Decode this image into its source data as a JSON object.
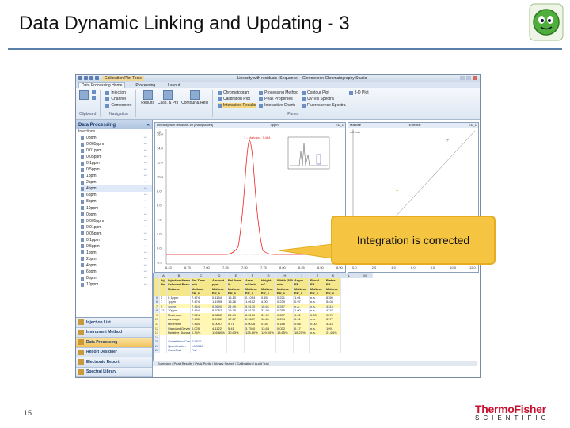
{
  "slide": {
    "title": "Data Dynamic Linking and Updating - 3",
    "page_number": "15",
    "company_word": "ThermoFisher",
    "company_sub": "SCIENTIFIC",
    "callout": "Integration is corrected"
  },
  "app": {
    "context_tab": "Calibration Plot Tools",
    "window_title": "Linearity with residuals (Sequence) - Chromeleon Chromatography Studio",
    "tabs": [
      "Data Processing Home",
      "Processing",
      "Layout"
    ],
    "ribbon": {
      "clipboard": "Clipboard",
      "navigation": "Navigation",
      "nav_items": [
        "Injection",
        "Channel",
        "Component"
      ],
      "results": [
        "Results",
        "Calib. & Ptfl",
        "Contour & Resi"
      ],
      "panes_label": "Panes",
      "panes_col1": [
        "Chromatogram",
        "Calibration Plot",
        "Interactive Results"
      ],
      "panes_col2": [
        "Processing Method",
        "Peak Properties",
        "Interactive Charts"
      ],
      "panes_col3": [
        "Contour Plot",
        "UV-Vis Spectra",
        "Fluorescence Spectra"
      ],
      "panes_col4": [
        "3-D Plot"
      ]
    },
    "nav": {
      "title": "Data Processing",
      "section": "Injections",
      "items": [
        "0ppm",
        "0.005ppm",
        "0.01ppm",
        "0.05ppm",
        "0.1ppm",
        "0.5ppm",
        "1ppm",
        "2ppm",
        "4ppm",
        "6ppm",
        "8ppm",
        "10ppm",
        "0ppm",
        "0.005ppm",
        "0.01ppm",
        "0.05ppm",
        "0.1ppm",
        "0.5ppm",
        "1ppm",
        "2ppm",
        "4ppm",
        "6ppm",
        "8ppm",
        "10ppm"
      ],
      "selected_index": 8,
      "buttons": [
        "Injection List",
        "Instrument Method",
        "Data Processing",
        "Report Designer",
        "Electronic Report",
        "Spectral Library"
      ]
    },
    "chromatogram": {
      "header": "Linearity with residuals #9 [manipulated]",
      "header_mid": "4ppm",
      "header_right": "ED_1",
      "unit": "nC",
      "peak_label": "1 - Maltose - 7.464",
      "y_ticks": [
        "16.0",
        "14.0",
        "12.0",
        "10.0",
        "8.0",
        "6.0",
        "4.0",
        "2.0",
        "0.0",
        "-2.0"
      ],
      "x_ticks": [
        "6.43",
        "6.75",
        "7.00",
        "7.25",
        "7.50",
        "7.75",
        "8.00",
        "8.25",
        "8.50",
        "8.90"
      ]
    },
    "calibration": {
      "header_left": "Maltose",
      "header_mid": "External",
      "header_right": "ED_1",
      "unit": "nC*min",
      "x_ticks": [
        "0.0",
        "2.0",
        "4.0",
        "6.0",
        "8.0",
        "10.0",
        "12.0"
      ]
    },
    "grid": {
      "letters": [
        "A",
        "B",
        "C",
        "D",
        "E",
        "F",
        "G",
        "H",
        "I",
        "J",
        "K",
        "L",
        "M"
      ],
      "header1": [
        "Inj.",
        "Injection Name",
        "Ret.Time",
        "Amount",
        "Rel.Area",
        "Area",
        "Height",
        "Width (50%)",
        "Asym.",
        "Resol.",
        "Plates"
      ],
      "header2": [
        "No.",
        "Selected Peak:",
        "min",
        "ppm",
        "%",
        "nC*min",
        "nC",
        "min",
        "EP",
        "EP",
        "EP"
      ],
      "header3": [
        "",
        "Maltose",
        "Maltose",
        "Maltose",
        "Maltose",
        "Maltose",
        "Maltose",
        "Maltose",
        "Maltose",
        "Maltose",
        "Maltose"
      ],
      "header4": [
        "",
        "",
        "ED_1",
        "ED_1",
        "ED_1",
        "ED_1",
        "ED_1",
        "ED_1",
        "ED_1",
        "ED_1",
        "ED_1"
      ],
      "rows": [
        {
          "n": "5",
          "cells": [
            "5",
            "0.1ppm",
            "7.474",
            "0.1154",
            "16.10",
            "0.1054",
            "0.45",
            "0.221",
            "1.01",
            "n.a.",
            "6350"
          ],
          "style": ""
        },
        {
          "n": "6",
          "cells": [
            "7",
            "1ppm",
            "7.474",
            "1.1995",
            "18.26",
            "1.0102",
            "4.00",
            "0.239",
            "0.97",
            "n.a.",
            "5404"
          ],
          "style": ""
        },
        {
          "n": "7",
          "cells": [
            "9",
            "4ppm",
            "7.464",
            "5.6600",
            "24.49",
            "5.5170",
            "16.61",
            "0.287",
            "n.a.",
            "n.a.",
            "4316"
          ],
          "style": "b"
        },
        {
          "n": "8",
          "cells": [
            "12",
            "10ppm",
            "7.464",
            "8.3252",
            "19.79",
            "8.5130",
            "31.92",
            "0.255",
            "1.00",
            "n.a.",
            "4747"
          ],
          "style": ""
        },
        {
          "n": "9",
          "cells": [
            "",
            "Maximum",
            "7.524",
            "8.3252",
            "24.49",
            "8.5130",
            "31.92",
            "0.287",
            "1.01",
            "0.00",
            "9070"
          ],
          "style": "y"
        },
        {
          "n": "10",
          "cells": [
            "",
            "Average",
            "7.480",
            "3.2432",
            "17.67",
            "2.9607",
            "10.61",
            "0.234",
            "0.91",
            "n.a.",
            "5977"
          ],
          "style": "y"
        },
        {
          "n": "11",
          "cells": [
            "",
            "Minimum",
            "7.464",
            "0.0097",
            "9.71",
            "0.0078",
            "0.04",
            "0.186",
            "0.68",
            "0.00",
            "4315"
          ],
          "style": "y"
        },
        {
          "n": "12",
          "cells": [
            "",
            "Standard Deviation",
            "0.025",
            "4.1122",
            "5.41",
            "3.7540",
            "13.68",
            "0.032",
            "0.17",
            "n.a.",
            "1991"
          ],
          "style": "y"
        },
        {
          "n": "13",
          "cells": [
            "",
            "Relative Standard Deviation",
            "0.34%",
            "126.80%",
            "30.63%",
            "126.80%",
            "129.00%",
            "13.65%",
            "18.21%",
            "n.a.",
            "21.64%"
          ],
          "style": "y"
        },
        {
          "n": "14",
          "cells": [
            "",
            "",
            "",
            "",
            "",
            "",
            "",
            "",
            "",
            "",
            ""
          ],
          "style": ""
        },
        {
          "n": "15",
          "cells": [
            "",
            "Correlation Coefficient",
            "0.9610",
            "",
            "",
            "",
            "",
            "",
            "",
            "",
            ""
          ],
          "style": "it"
        },
        {
          "n": "16",
          "cells": [
            "",
            "Specification",
            ">0.9990",
            "",
            "",
            "",
            "",
            "",
            "",
            "",
            ""
          ],
          "style": "it"
        },
        {
          "n": "17",
          "cells": [
            "",
            "Pass/Fail",
            "Fail",
            "",
            "",
            "",
            "",
            "",
            "",
            "",
            ""
          ],
          "style": "it"
        }
      ],
      "sheet_tabs": "Summary / Peak Results / Peak Purity / Library Search / Calibration / Audit Trail"
    }
  }
}
